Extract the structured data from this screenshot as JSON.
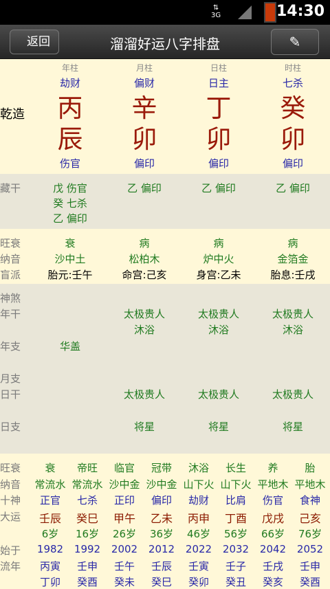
{
  "status_bar": {
    "network": "3G",
    "time": "14:30"
  },
  "title_bar": {
    "back_label": "返回",
    "title": "溜溜好运八字排盘"
  },
  "pillar_headers": [
    "年柱",
    "月柱",
    "日柱",
    "时柱"
  ],
  "stem_gods": [
    "劫财",
    "偏财",
    "日主",
    "七杀"
  ],
  "gender_label": "乾造",
  "stems": [
    "丙",
    "辛",
    "丁",
    "癸"
  ],
  "branches": [
    "辰",
    "卯",
    "卯",
    "卯"
  ],
  "branch_gods": [
    "伤官",
    "偏印",
    "偏印",
    "偏印"
  ],
  "hidden": {
    "label": "藏干",
    "col0": [
      "戊 伤官",
      "癸 七杀",
      "乙 偏印"
    ],
    "col1": [
      "乙 偏印"
    ],
    "col2": [
      "乙 偏印"
    ],
    "col3": [
      "乙 偏印"
    ]
  },
  "info": {
    "wangshuai_label": "旺衰",
    "wangshuai": [
      "衰",
      "病",
      "病",
      "病"
    ],
    "nayin_label": "纳音",
    "nayin": [
      "沙中土",
      "松柏木",
      "炉中火",
      "金箔金"
    ],
    "mangpai_label": "盲派",
    "mangpai": [
      "胎元:壬午",
      "命宫:己亥",
      "身宫:乙未",
      "胎息:壬戌"
    ]
  },
  "shensha": {
    "label": "神煞",
    "niangan_label": "年干",
    "niangan": [
      [
        "太极贵人",
        "沐浴"
      ],
      [
        "太极贵人",
        "沐浴"
      ],
      [
        "太极贵人",
        "沐浴"
      ]
    ],
    "nianzhi_label": "年支",
    "nianzhi": "华盖",
    "yuezhi_label": "月支",
    "rigan_label": "日干",
    "rigan": [
      "太极贵人",
      "太极贵人",
      "太极贵人"
    ],
    "rizhi_label": "日支",
    "rizhi": [
      "将星",
      "将星",
      "将星"
    ]
  },
  "dayun": {
    "wangshuai_label": "旺衰",
    "wangshuai": [
      "衰",
      "帝旺",
      "临官",
      "冠带",
      "沐浴",
      "长生",
      "养",
      "胎"
    ],
    "nayin_label": "纳音",
    "nayin": [
      "常流水",
      "常流水",
      "沙中金",
      "沙中金",
      "山下火",
      "山下火",
      "平地木",
      "平地木"
    ],
    "shishen_label": "十神",
    "shishen": [
      "正官",
      "七杀",
      "正印",
      "偏印",
      "劫财",
      "比肩",
      "伤官",
      "食神"
    ],
    "dayun_label": "大运",
    "dayun": [
      "壬辰",
      "癸巳",
      "甲午",
      "乙未",
      "丙申",
      "丁酉",
      "戊戌",
      "己亥"
    ],
    "ages": [
      "6岁",
      "16岁",
      "26岁",
      "36岁",
      "46岁",
      "56岁",
      "66岁",
      "76岁"
    ],
    "start_label": "始于",
    "start": [
      "1982",
      "1992",
      "2002",
      "2012",
      "2022",
      "2032",
      "2042",
      "2052"
    ],
    "liunian_label": "流年",
    "liunian1": [
      "丙寅",
      "壬申",
      "壬午",
      "壬辰",
      "壬寅",
      "壬子",
      "壬戌",
      "壬申"
    ],
    "liunian2": [
      "丁卯",
      "癸酉",
      "癸未",
      "癸巳",
      "癸卯",
      "癸丑",
      "癸亥",
      "癸酉"
    ]
  }
}
